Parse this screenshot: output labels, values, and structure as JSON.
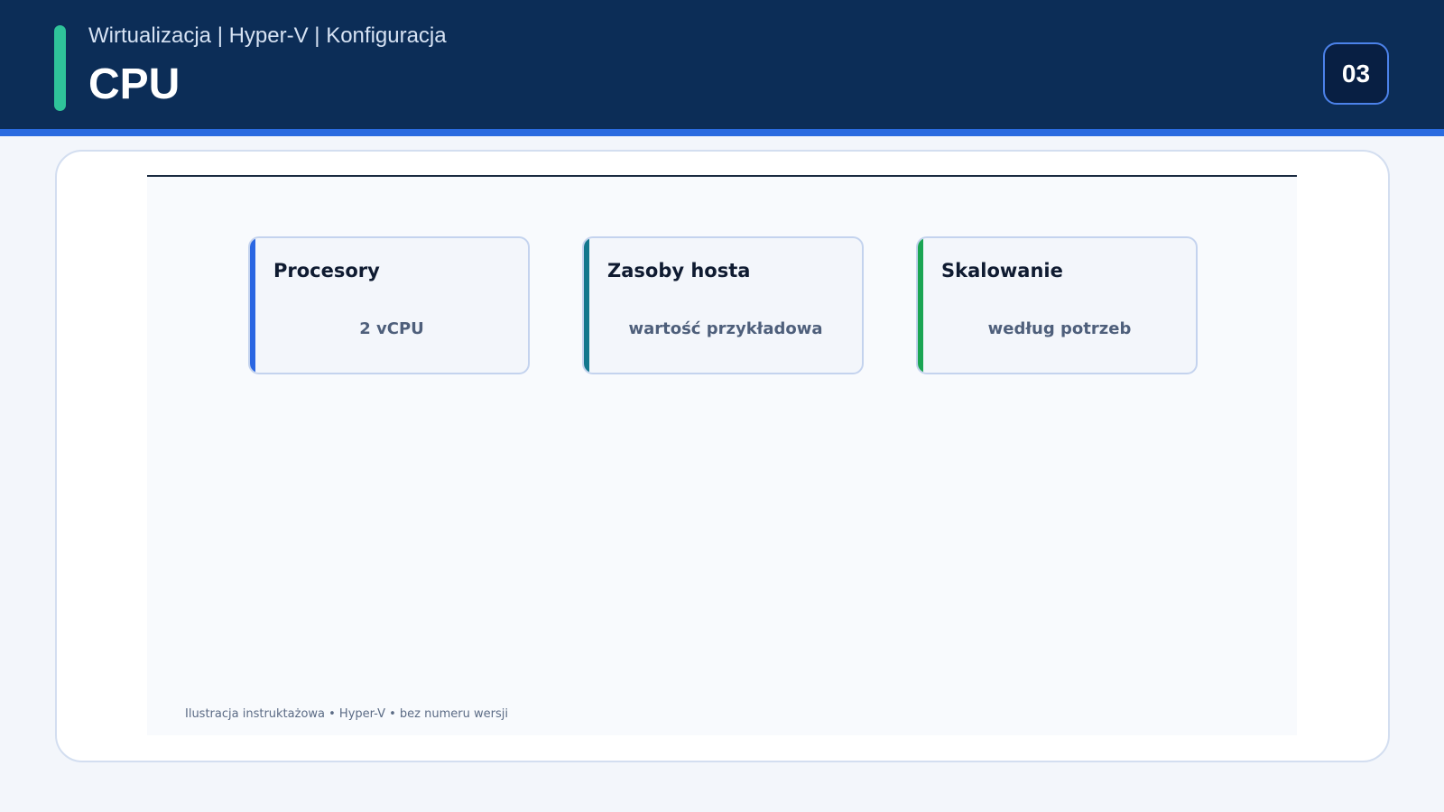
{
  "header": {
    "breadcrumb": "Wirtualizacja | Hyper-V | Konfiguracja",
    "title": "CPU",
    "slide_number": "03"
  },
  "cards": [
    {
      "title": "Procesory",
      "value": "2 vCPU",
      "accent_color": "#2a66e2"
    },
    {
      "title": "Zasoby hosta",
      "value": "wartość przykładowa",
      "accent_color": "#13778d"
    },
    {
      "title": "Skalowanie",
      "value": "według potrzeb",
      "accent_color": "#1aa553"
    }
  ],
  "footer": {
    "note": "Ilustracja instruktażowa • Hyper-V • bez numeru wersji"
  },
  "colors": {
    "header_bg": "#0c2d57",
    "header_rule": "#2a6be0",
    "accent_bar": "#2fc39a",
    "page_bg": "#f3f6fb"
  }
}
